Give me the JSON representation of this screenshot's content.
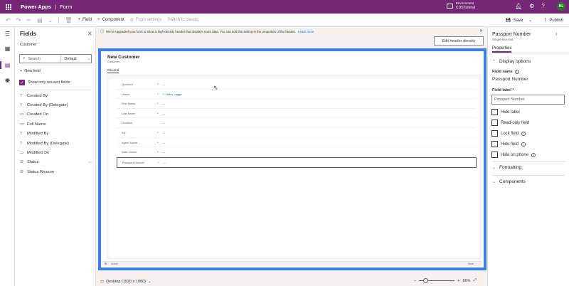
{
  "topbar": {
    "app_name": "Power Apps",
    "separator": "|",
    "page_name": "Form",
    "environment_label": "Environment",
    "environment_name": "CDSTutorial",
    "avatar_initials": "HL"
  },
  "cmdbar": {
    "add_field": "Field",
    "add_component": "Component",
    "form_settings": "Form settings",
    "switch_classic": "Switch to classic",
    "save": "Save",
    "publish": "Publish"
  },
  "fields_panel": {
    "title": "Fields",
    "entity": "Customer",
    "search_placeholder": "Search",
    "filter_value": "Default",
    "new_field": "New field",
    "show_unused": "Show only unused fields",
    "items": [
      {
        "label": "Created By"
      },
      {
        "label": "Created By (Delegate)"
      },
      {
        "label": "Created On"
      },
      {
        "label": "Full Name"
      },
      {
        "label": "Modified By"
      },
      {
        "label": "Modified By (Delegate)"
      },
      {
        "label": "Modified On"
      },
      {
        "label": "Status"
      },
      {
        "label": "Status Reason"
      }
    ]
  },
  "infobar": {
    "message": "We've upgraded your form to show a high density header that displays more data. You can edit this setting in the properties of the header.",
    "link": "Learn more",
    "header_density_button": "Edit header density"
  },
  "form": {
    "title": "New Customer",
    "subtitle": "Customer",
    "tab": "General",
    "rows": [
      {
        "label": "Question",
        "req": "*",
        "value": "---"
      },
      {
        "label": "Owner",
        "req": "*",
        "value": "Henry Legge"
      },
      {
        "label": "First Name",
        "req": "*",
        "value": "---"
      },
      {
        "label": "Last Name",
        "req": "*",
        "value": "---"
      },
      {
        "label": "Location",
        "req": "",
        "value": "---"
      },
      {
        "label": "Kill",
        "req": "*",
        "value": "---"
      },
      {
        "label": "Agent Name",
        "req": "*",
        "value": "---"
      },
      {
        "label": "Date Joined",
        "req": "*",
        "value": "---"
      },
      {
        "label": "Passport Number",
        "req": "*",
        "value": "---"
      }
    ],
    "footer_left": "Active",
    "footer_right": "Save"
  },
  "statusbar": {
    "device": "Desktop (1920 x 1080)",
    "zoom": "66%"
  },
  "properties": {
    "title": "Passport Number",
    "subtitle": "Single-line text",
    "tab": "Properties",
    "display_options": "Display options",
    "field_name_label": "Field name",
    "field_name_value": "Passport Number",
    "field_label_label": "Field label *",
    "field_label_value": "Passport Number",
    "hide_label": "Hide label",
    "read_only": "Read-only field",
    "lock_field": "Lock field",
    "hide_field": "Hide field",
    "hide_on_phone": "Hide on phone",
    "formatting": "Formatting",
    "components": "Components"
  },
  "colors": {
    "brand": "#742774",
    "selection_frame": "#3a7ee6"
  }
}
